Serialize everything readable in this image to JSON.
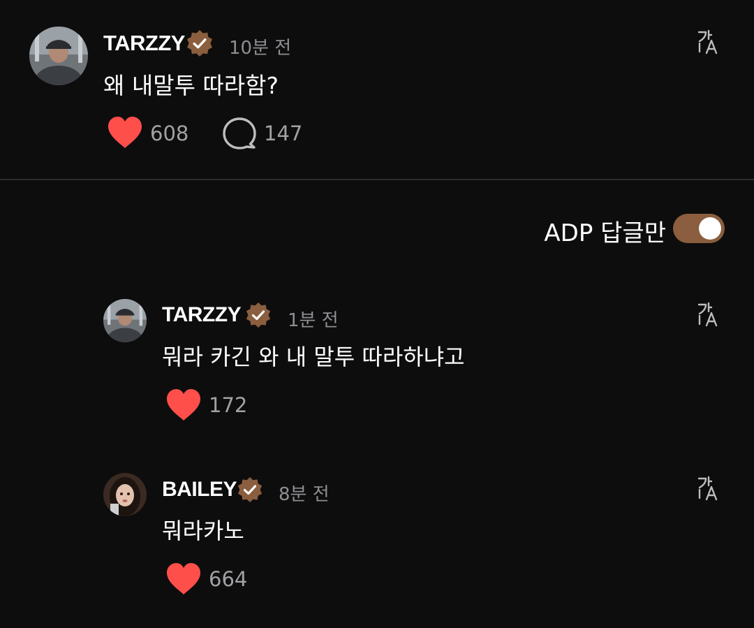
{
  "post": {
    "username": "TARZZY",
    "time": "10분 전",
    "text": "왜 내말투 따라함?",
    "likes": "608",
    "comments": "147"
  },
  "filter": {
    "label": "ADP 답글만",
    "enabled": true
  },
  "replies": [
    {
      "username": "TARZZY",
      "time": "1분 전",
      "text": "뭐라 카긴 와 내 말투 따라하냐고",
      "likes": "172"
    },
    {
      "username": "BAILEY",
      "time": "8분 전",
      "text": "뭐라카노",
      "likes": "664"
    }
  ],
  "colors": {
    "background": "#0e0d0d",
    "heart": "#ff4f4b",
    "badge": "#8a5e3e",
    "toggle": "#8a5e3e",
    "muted": "#8e8e93"
  },
  "icons": {
    "verified": "verified-badge-icon",
    "translate": "translate-icon",
    "like": "heart-icon",
    "comment": "comment-bubble-icon"
  }
}
